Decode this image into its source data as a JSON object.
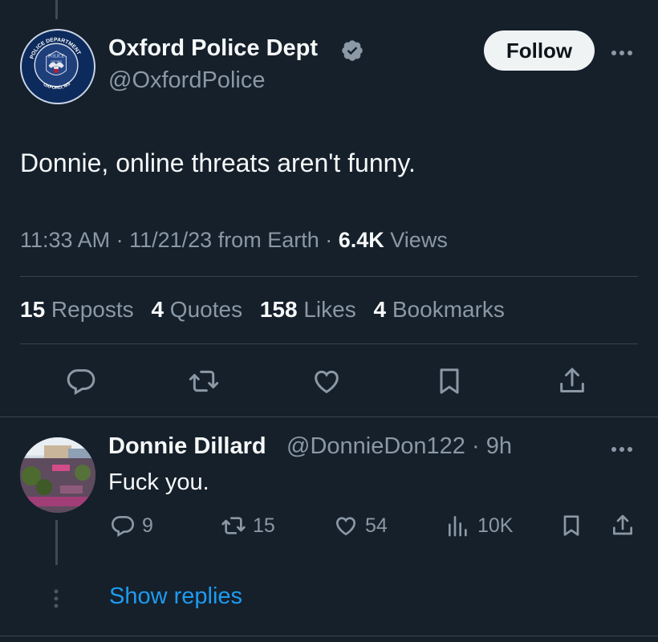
{
  "tweet": {
    "author_name": "Oxford Police Dept",
    "author_handle": "@OxfordPolice",
    "follow_label": "Follow",
    "text": "Donnie, online threats aren't funny.",
    "time": "11:33 AM",
    "separator1": " · ",
    "date": "11/21/23",
    "source": " from Earth",
    "separator2": " · ",
    "views_count": "6.4K",
    "views_label": " Views",
    "avatar_text": {
      "top_ring": "POLICE DEPARTMENT",
      "left_ring": "OXFORD",
      "bottom_ring": "OXFORD, MS",
      "center": "POLICE",
      "center_sub": "OXFORD"
    }
  },
  "stats": [
    {
      "count": "15",
      "label": " Reposts"
    },
    {
      "count": "4",
      "label": " Quotes"
    },
    {
      "count": "158",
      "label": " Likes"
    },
    {
      "count": "4",
      "label": " Bookmarks"
    }
  ],
  "actions": [
    "reply-icon",
    "repost-icon",
    "like-icon",
    "bookmark-icon",
    "share-icon"
  ],
  "reply": {
    "author_name": "Donnie Dillard",
    "author_handle": "@DonnieDon122",
    "time_sep": " · ",
    "time": "9h",
    "text": "Fuck you.",
    "replies": "9",
    "reposts": "15",
    "likes": "54",
    "views": "10K"
  },
  "show_replies_label": "Show replies",
  "colors": {
    "background": "#15202b",
    "text": "#f7f9f9",
    "muted": "#8b98a5",
    "accent": "#1d9bf0",
    "divider": "#38444d",
    "verified": "#8b98a5"
  }
}
